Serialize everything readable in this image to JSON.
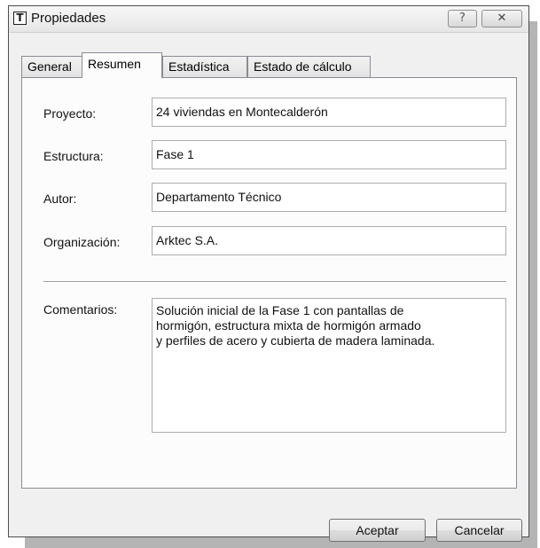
{
  "window": {
    "title": "Propiedades",
    "app_icon_glyph": "T",
    "help_glyph": "?",
    "close_glyph": "✕"
  },
  "tabs": [
    {
      "label": "General",
      "active": false
    },
    {
      "label": "Resumen",
      "active": true
    },
    {
      "label": "Estadística",
      "active": false
    },
    {
      "label": "Estado de cálculo",
      "active": false
    }
  ],
  "form": {
    "proyecto_label": "Proyecto:",
    "proyecto_value": "24 viviendas en Montecalderón",
    "estructura_label": "Estructura:",
    "estructura_value": "Fase 1",
    "autor_label": "Autor:",
    "autor_value": "Departamento Técnico",
    "organizacion_label": "Organización:",
    "organizacion_value": "Arktec S.A.",
    "comentarios_label": "Comentarios:",
    "comentarios_value": "Solución inicial de la Fase 1 con pantallas de\nhormigón, estructura mixta de hormigón armado\ny perfiles de acero y cubierta de madera laminada."
  },
  "buttons": {
    "ok_label": "Aceptar",
    "cancel_label": "Cancelar"
  },
  "icons": {
    "app": "app-t-icon",
    "help": "help-icon",
    "close": "close-icon"
  }
}
